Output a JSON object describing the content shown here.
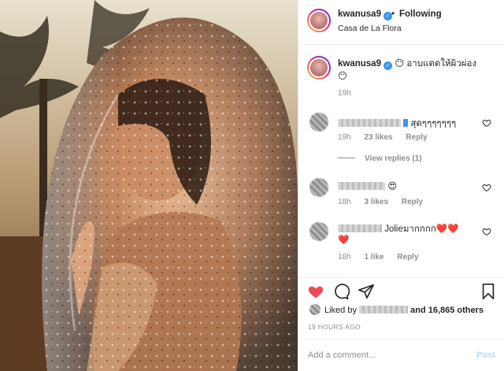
{
  "post": {
    "username": "kwanusa9",
    "follow_dot": "•",
    "follow_label": "Following",
    "location": "Casa de La Flora"
  },
  "caption": {
    "username": "kwanusa9",
    "text": "อาบแดดให้ผิวผ่อง",
    "emoji_start": "😶",
    "emoji_end": "😶",
    "time": "19h"
  },
  "comments": [
    {
      "text": "สุดๆๆๆๆๆๆๆ",
      "time": "19h",
      "likes": "23 likes",
      "reply": "Reply"
    },
    {
      "text": "😍",
      "time": "18h",
      "likes": "3 likes",
      "reply": "Reply"
    },
    {
      "text": "Jolieมากกกก❤️❤️",
      "text2": "❤️",
      "time": "18h",
      "likes": "1 like",
      "reply": "Reply"
    }
  ],
  "view_replies": "View replies (1)",
  "likes": {
    "prefix": "Liked by",
    "suffix": "and 16,865 others"
  },
  "timestamp": "19 HOURS AGO",
  "comment_box": {
    "placeholder": "Add a comment...",
    "post_label": "Post"
  },
  "icons": [
    "heart-icon",
    "comment-icon",
    "share-icon",
    "bookmark-icon",
    "verified-icon"
  ],
  "colors": {
    "like_red": "#ed4956",
    "link_blue": "#3897f0",
    "post_disabled": "#b3dbff"
  }
}
